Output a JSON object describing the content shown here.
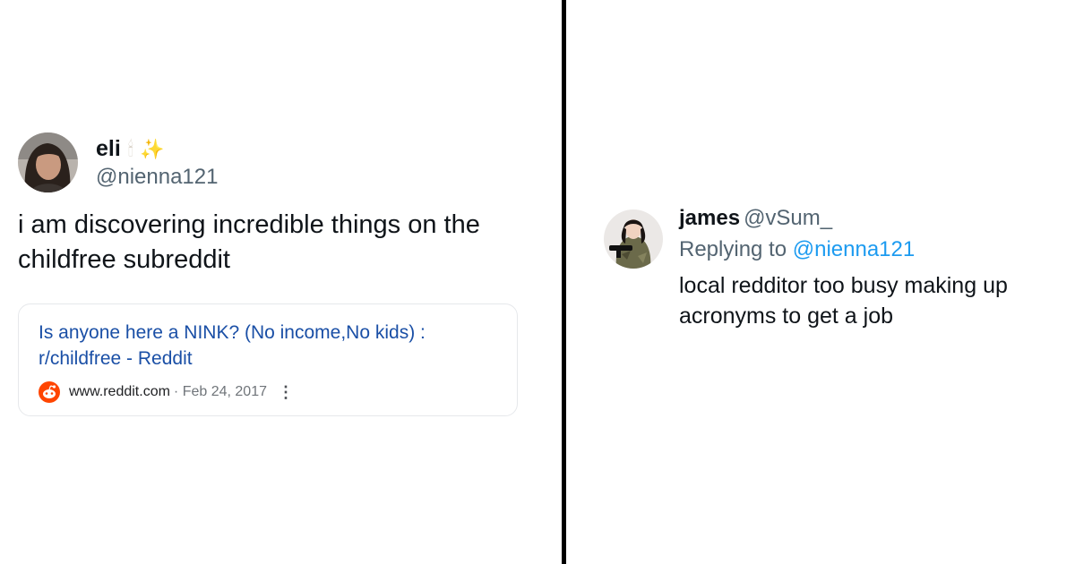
{
  "left_tweet": {
    "display_name": "eli",
    "emoji": [
      "🕯",
      "✨"
    ],
    "handle": "@nienna121",
    "text": "i am discovering incredible things on the childfree subreddit",
    "link_card": {
      "title": "Is anyone here a NINK? (No income,No kids) : r/childfree - Reddit",
      "site": "www.reddit.com",
      "date": "· Feb 24, 2017",
      "more_icon": "⋮"
    }
  },
  "right_tweet": {
    "display_name": "james",
    "handle": "@vSum_",
    "replying_prefix": "Replying to",
    "replying_mention": "@nienna121",
    "text": "local redditor too busy making up acronyms to get a job"
  },
  "colors": {
    "link": "#1a4fa6",
    "mention": "#1d9bf0",
    "secondary": "#536471",
    "reddit": "#ff4500"
  }
}
